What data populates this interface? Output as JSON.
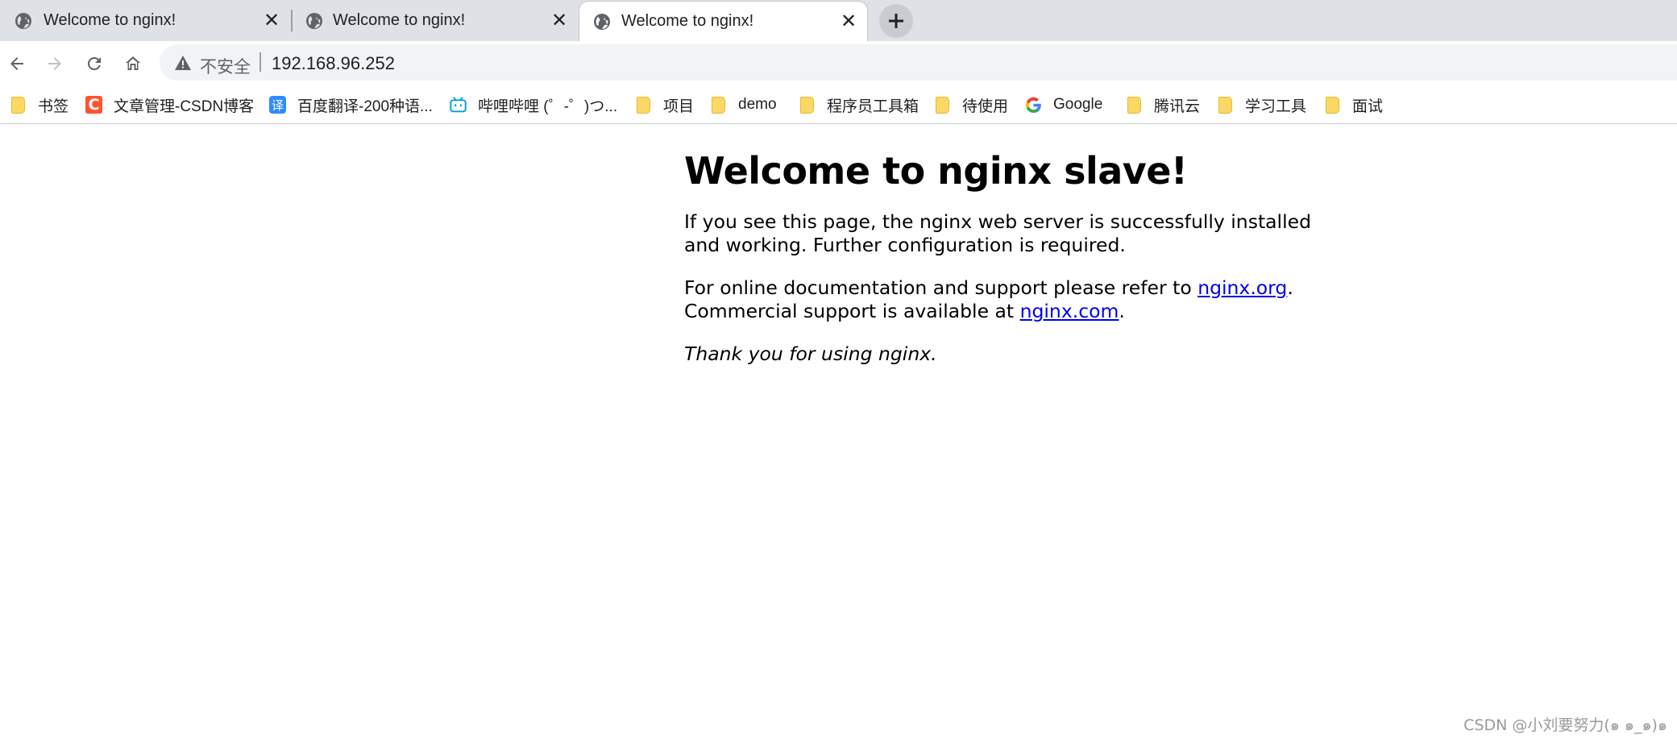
{
  "tabs": [
    {
      "title": "Welcome to nginx!",
      "close": "✕"
    },
    {
      "title": "Welcome to nginx!",
      "close": "✕"
    },
    {
      "title": "Welcome to nginx!",
      "close": "✕",
      "active": true
    }
  ],
  "new_tab_symbol": "+",
  "toolbar": {
    "security_label": "不安全",
    "url": "192.168.96.252"
  },
  "bookmarks": [
    {
      "label": "书签",
      "icon": "folder-icon"
    },
    {
      "label": "文章管理-CSDN博客",
      "icon": "csdn-icon",
      "glyph": "C"
    },
    {
      "label": "百度翻译-200种语...",
      "icon": "baidu-translate-icon",
      "glyph": "译"
    },
    {
      "label": "哔哩哔哩 (゜-゜)つ...",
      "icon": "bilibili-icon"
    },
    {
      "label": "项目",
      "icon": "folder-icon"
    },
    {
      "label": "demo",
      "icon": "folder-icon"
    },
    {
      "label": "程序员工具箱",
      "icon": "folder-icon"
    },
    {
      "label": "待使用",
      "icon": "folder-icon"
    },
    {
      "label": "Google",
      "icon": "google-icon"
    },
    {
      "label": "腾讯云",
      "icon": "folder-icon"
    },
    {
      "label": "学习工具",
      "icon": "folder-icon"
    },
    {
      "label": "面试",
      "icon": "folder-icon"
    }
  ],
  "page": {
    "heading": "Welcome to nginx slave!",
    "para1": "If you see this page, the nginx web server is successfully installed and working. Further configuration is required.",
    "para2_prefix": "For online documentation and support please refer to ",
    "link1": "nginx.org",
    "para2_mid": ".",
    "para2_line2_prefix": "Commercial support is available at ",
    "link2": "nginx.com",
    "para2_suffix": ".",
    "thanks": "Thank you for using nginx."
  },
  "watermark": "CSDN @小刘要努力(๑ ๑_๑)๑",
  "colors": {
    "tabstrip_bg": "#dee1e6",
    "omnibox_bg": "#f1f3f4",
    "link": "#0000ee",
    "folder": "#fbd866",
    "csdn": "#fc5531",
    "baidu": "#2f8bff",
    "bilibili": "#00a1d6"
  }
}
